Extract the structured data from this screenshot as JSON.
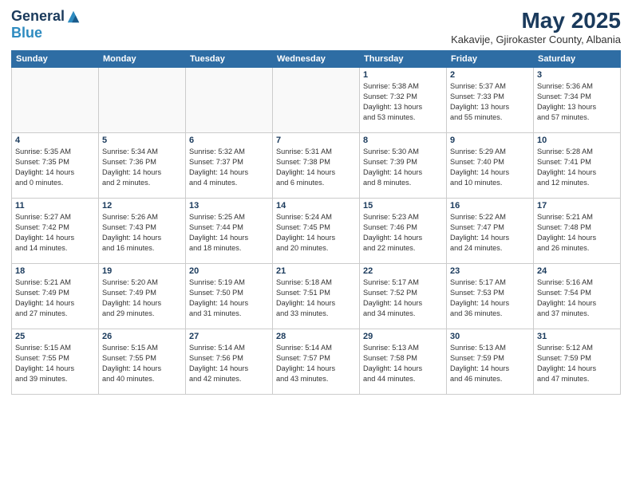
{
  "header": {
    "logo_general": "General",
    "logo_blue": "Blue",
    "title": "May 2025",
    "subtitle": "Kakavije, Gjirokaster County, Albania"
  },
  "weekdays": [
    "Sunday",
    "Monday",
    "Tuesday",
    "Wednesday",
    "Thursday",
    "Friday",
    "Saturday"
  ],
  "weeks": [
    [
      {
        "day": "",
        "info": ""
      },
      {
        "day": "",
        "info": ""
      },
      {
        "day": "",
        "info": ""
      },
      {
        "day": "",
        "info": ""
      },
      {
        "day": "1",
        "info": "Sunrise: 5:38 AM\nSunset: 7:32 PM\nDaylight: 13 hours\nand 53 minutes."
      },
      {
        "day": "2",
        "info": "Sunrise: 5:37 AM\nSunset: 7:33 PM\nDaylight: 13 hours\nand 55 minutes."
      },
      {
        "day": "3",
        "info": "Sunrise: 5:36 AM\nSunset: 7:34 PM\nDaylight: 13 hours\nand 57 minutes."
      }
    ],
    [
      {
        "day": "4",
        "info": "Sunrise: 5:35 AM\nSunset: 7:35 PM\nDaylight: 14 hours\nand 0 minutes."
      },
      {
        "day": "5",
        "info": "Sunrise: 5:34 AM\nSunset: 7:36 PM\nDaylight: 14 hours\nand 2 minutes."
      },
      {
        "day": "6",
        "info": "Sunrise: 5:32 AM\nSunset: 7:37 PM\nDaylight: 14 hours\nand 4 minutes."
      },
      {
        "day": "7",
        "info": "Sunrise: 5:31 AM\nSunset: 7:38 PM\nDaylight: 14 hours\nand 6 minutes."
      },
      {
        "day": "8",
        "info": "Sunrise: 5:30 AM\nSunset: 7:39 PM\nDaylight: 14 hours\nand 8 minutes."
      },
      {
        "day": "9",
        "info": "Sunrise: 5:29 AM\nSunset: 7:40 PM\nDaylight: 14 hours\nand 10 minutes."
      },
      {
        "day": "10",
        "info": "Sunrise: 5:28 AM\nSunset: 7:41 PM\nDaylight: 14 hours\nand 12 minutes."
      }
    ],
    [
      {
        "day": "11",
        "info": "Sunrise: 5:27 AM\nSunset: 7:42 PM\nDaylight: 14 hours\nand 14 minutes."
      },
      {
        "day": "12",
        "info": "Sunrise: 5:26 AM\nSunset: 7:43 PM\nDaylight: 14 hours\nand 16 minutes."
      },
      {
        "day": "13",
        "info": "Sunrise: 5:25 AM\nSunset: 7:44 PM\nDaylight: 14 hours\nand 18 minutes."
      },
      {
        "day": "14",
        "info": "Sunrise: 5:24 AM\nSunset: 7:45 PM\nDaylight: 14 hours\nand 20 minutes."
      },
      {
        "day": "15",
        "info": "Sunrise: 5:23 AM\nSunset: 7:46 PM\nDaylight: 14 hours\nand 22 minutes."
      },
      {
        "day": "16",
        "info": "Sunrise: 5:22 AM\nSunset: 7:47 PM\nDaylight: 14 hours\nand 24 minutes."
      },
      {
        "day": "17",
        "info": "Sunrise: 5:21 AM\nSunset: 7:48 PM\nDaylight: 14 hours\nand 26 minutes."
      }
    ],
    [
      {
        "day": "18",
        "info": "Sunrise: 5:21 AM\nSunset: 7:49 PM\nDaylight: 14 hours\nand 27 minutes."
      },
      {
        "day": "19",
        "info": "Sunrise: 5:20 AM\nSunset: 7:49 PM\nDaylight: 14 hours\nand 29 minutes."
      },
      {
        "day": "20",
        "info": "Sunrise: 5:19 AM\nSunset: 7:50 PM\nDaylight: 14 hours\nand 31 minutes."
      },
      {
        "day": "21",
        "info": "Sunrise: 5:18 AM\nSunset: 7:51 PM\nDaylight: 14 hours\nand 33 minutes."
      },
      {
        "day": "22",
        "info": "Sunrise: 5:17 AM\nSunset: 7:52 PM\nDaylight: 14 hours\nand 34 minutes."
      },
      {
        "day": "23",
        "info": "Sunrise: 5:17 AM\nSunset: 7:53 PM\nDaylight: 14 hours\nand 36 minutes."
      },
      {
        "day": "24",
        "info": "Sunrise: 5:16 AM\nSunset: 7:54 PM\nDaylight: 14 hours\nand 37 minutes."
      }
    ],
    [
      {
        "day": "25",
        "info": "Sunrise: 5:15 AM\nSunset: 7:55 PM\nDaylight: 14 hours\nand 39 minutes."
      },
      {
        "day": "26",
        "info": "Sunrise: 5:15 AM\nSunset: 7:55 PM\nDaylight: 14 hours\nand 40 minutes."
      },
      {
        "day": "27",
        "info": "Sunrise: 5:14 AM\nSunset: 7:56 PM\nDaylight: 14 hours\nand 42 minutes."
      },
      {
        "day": "28",
        "info": "Sunrise: 5:14 AM\nSunset: 7:57 PM\nDaylight: 14 hours\nand 43 minutes."
      },
      {
        "day": "29",
        "info": "Sunrise: 5:13 AM\nSunset: 7:58 PM\nDaylight: 14 hours\nand 44 minutes."
      },
      {
        "day": "30",
        "info": "Sunrise: 5:13 AM\nSunset: 7:59 PM\nDaylight: 14 hours\nand 46 minutes."
      },
      {
        "day": "31",
        "info": "Sunrise: 5:12 AM\nSunset: 7:59 PM\nDaylight: 14 hours\nand 47 minutes."
      }
    ]
  ]
}
